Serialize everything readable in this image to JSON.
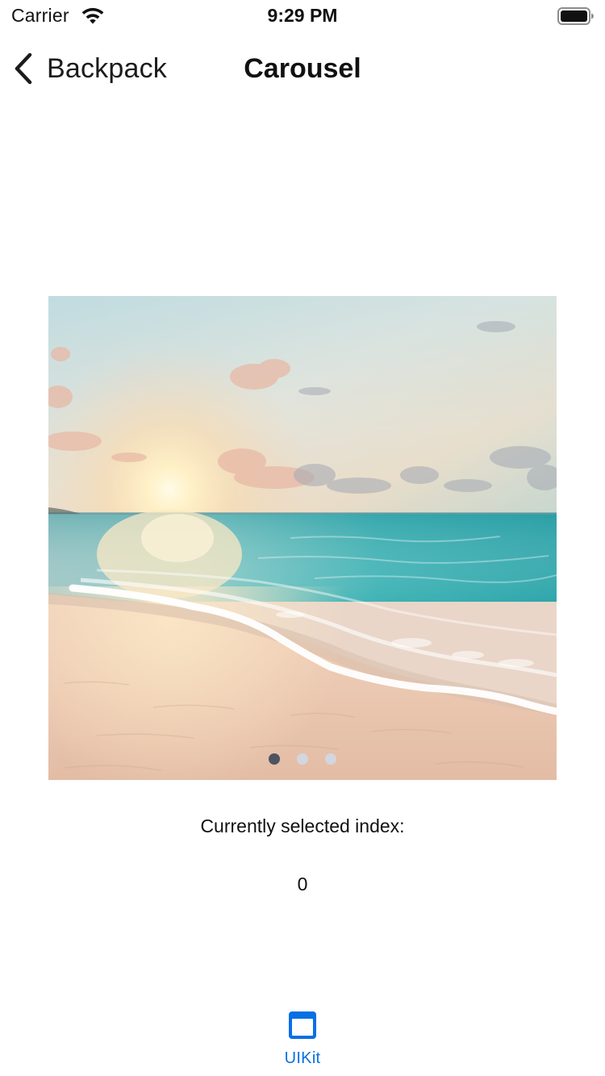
{
  "status_bar": {
    "carrier": "Carrier",
    "time": "9:29 PM",
    "wifi_icon": "wifi-icon",
    "battery_icon": "battery-full-icon"
  },
  "nav": {
    "back_label": "Backpack",
    "back_icon": "chevron-left-icon",
    "title": "Carousel"
  },
  "carousel": {
    "image_subject": "beach-sunset-photo",
    "page_count": 3,
    "current_page": 0
  },
  "index": {
    "caption": "Currently selected index:",
    "value": "0"
  },
  "tab_bar": {
    "items": [
      {
        "label": "UIKit",
        "icon": "window-icon",
        "selected": true
      }
    ]
  },
  "colors": {
    "accent": "#0770e3",
    "dot_active": "#4d5461",
    "dot_inactive": "#d2d6de"
  }
}
